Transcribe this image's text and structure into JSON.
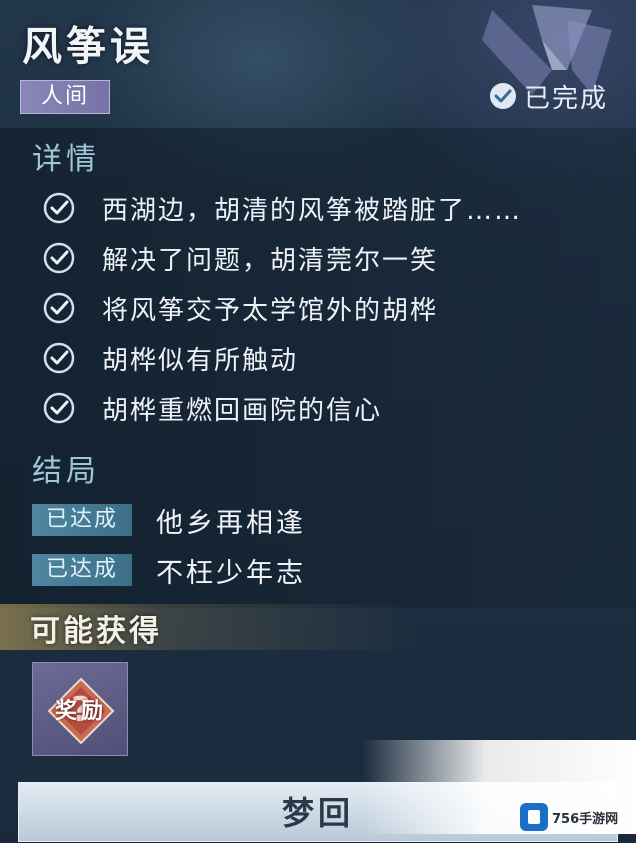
{
  "quest": {
    "title": "风筝误",
    "category_tag": "人间",
    "status_text": "已完成"
  },
  "details": {
    "heading": "详情",
    "items": [
      {
        "text": "西湖边，胡清的风筝被踏脏了……"
      },
      {
        "text": "解决了问题，胡清莞尔一笑"
      },
      {
        "text": "将风筝交予太学馆外的胡桦"
      },
      {
        "text": "胡桦似有所触动"
      },
      {
        "text": "胡桦重燃回画院的信心"
      }
    ]
  },
  "ending": {
    "heading": "结局",
    "items": [
      {
        "badge": "已达成",
        "text": "他乡再相逢"
      },
      {
        "badge": "已达成",
        "text": "不枉少年志"
      }
    ]
  },
  "rewards": {
    "heading": "可能获得",
    "items": [
      {
        "label": "奖励",
        "icon": "question-mark-icon"
      }
    ]
  },
  "actions": {
    "main_button_label": "梦回"
  },
  "watermark": {
    "text": "756手游网"
  },
  "colors": {
    "background": "#1d2f42",
    "tag_purple": "#8a86b8",
    "badge_teal": "#4f86a0",
    "section_heading": "#9fc6d7",
    "button_light": "#dde7f0"
  }
}
